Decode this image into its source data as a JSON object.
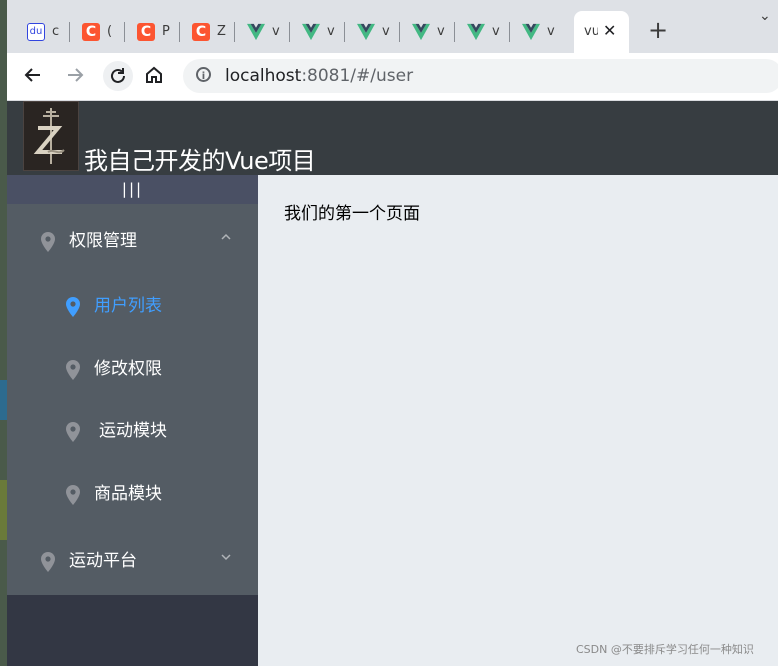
{
  "browser": {
    "tabs": [
      {
        "icon": "baidu-icon",
        "icon_text": "du",
        "title": "c"
      },
      {
        "icon": "csdn-icon",
        "icon_text": "C",
        "title": "("
      },
      {
        "icon": "csdn-icon",
        "icon_text": "C",
        "title": "P"
      },
      {
        "icon": "csdn-icon",
        "icon_text": "C",
        "title": "Z"
      },
      {
        "icon": "vue-icon",
        "title": "v"
      },
      {
        "icon": "vue-icon",
        "title": "v"
      },
      {
        "icon": "vue-icon",
        "title": "v"
      },
      {
        "icon": "vue-icon",
        "title": "v"
      },
      {
        "icon": "vue-icon",
        "title": "v"
      },
      {
        "icon": "vue-icon",
        "title": "v"
      }
    ],
    "active_tab": {
      "title": "vu",
      "close": "✕"
    },
    "new_tab": "+",
    "tab_menu": "⌄",
    "url_host": "localhost",
    "url_rest": ":8081/#/user"
  },
  "app": {
    "title": "我自己开发的Vue项目",
    "collapse_label": "|||",
    "menu": {
      "group1": "权限管理",
      "items": [
        "用户列表",
        "修改权限",
        "运动模块",
        "商品模块"
      ],
      "group2": "运动平台"
    },
    "page_text": "我们的第一个页面",
    "watermark": "CSDN @不要排斥学习任何一种知识"
  },
  "colors": {
    "header": "#373d41",
    "aside": "#333744",
    "menu": "#545c64",
    "active": "#409eff",
    "main": "#e9edf1"
  }
}
